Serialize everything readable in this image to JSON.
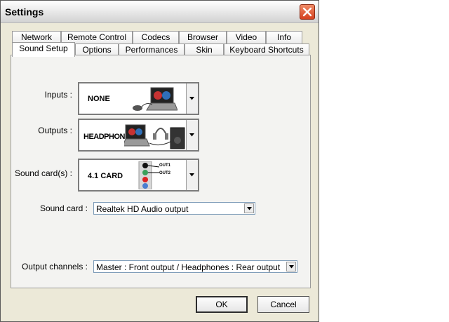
{
  "window": {
    "title": "Settings"
  },
  "tabs_row1": [
    "Network",
    "Remote Control",
    "Codecs",
    "Browser",
    "Video",
    "Info"
  ],
  "tabs_row2": [
    "Sound Setup",
    "Options",
    "Performances",
    "Skin",
    "Keyboard Shortcuts"
  ],
  "active_tab": "Sound Setup",
  "inputs": {
    "label": "Inputs :",
    "value": "NONE"
  },
  "outputs": {
    "label": "Outputs :",
    "value": "HEADPHONES"
  },
  "soundcards": {
    "label": "Sound card(s) :",
    "value": "4.1 CARD",
    "out1": "OUT1",
    "out2": "OUT2"
  },
  "soundcard": {
    "label": "Sound card :",
    "value": "Realtek HD Audio output"
  },
  "output_channels": {
    "label": "Output channels :",
    "value": "Master : Front output / Headphones : Rear output"
  },
  "buttons": {
    "ok": "OK",
    "cancel": "Cancel"
  },
  "colors": {
    "close_button": "#d5411f",
    "dialog_bg": "#ece9d8"
  }
}
